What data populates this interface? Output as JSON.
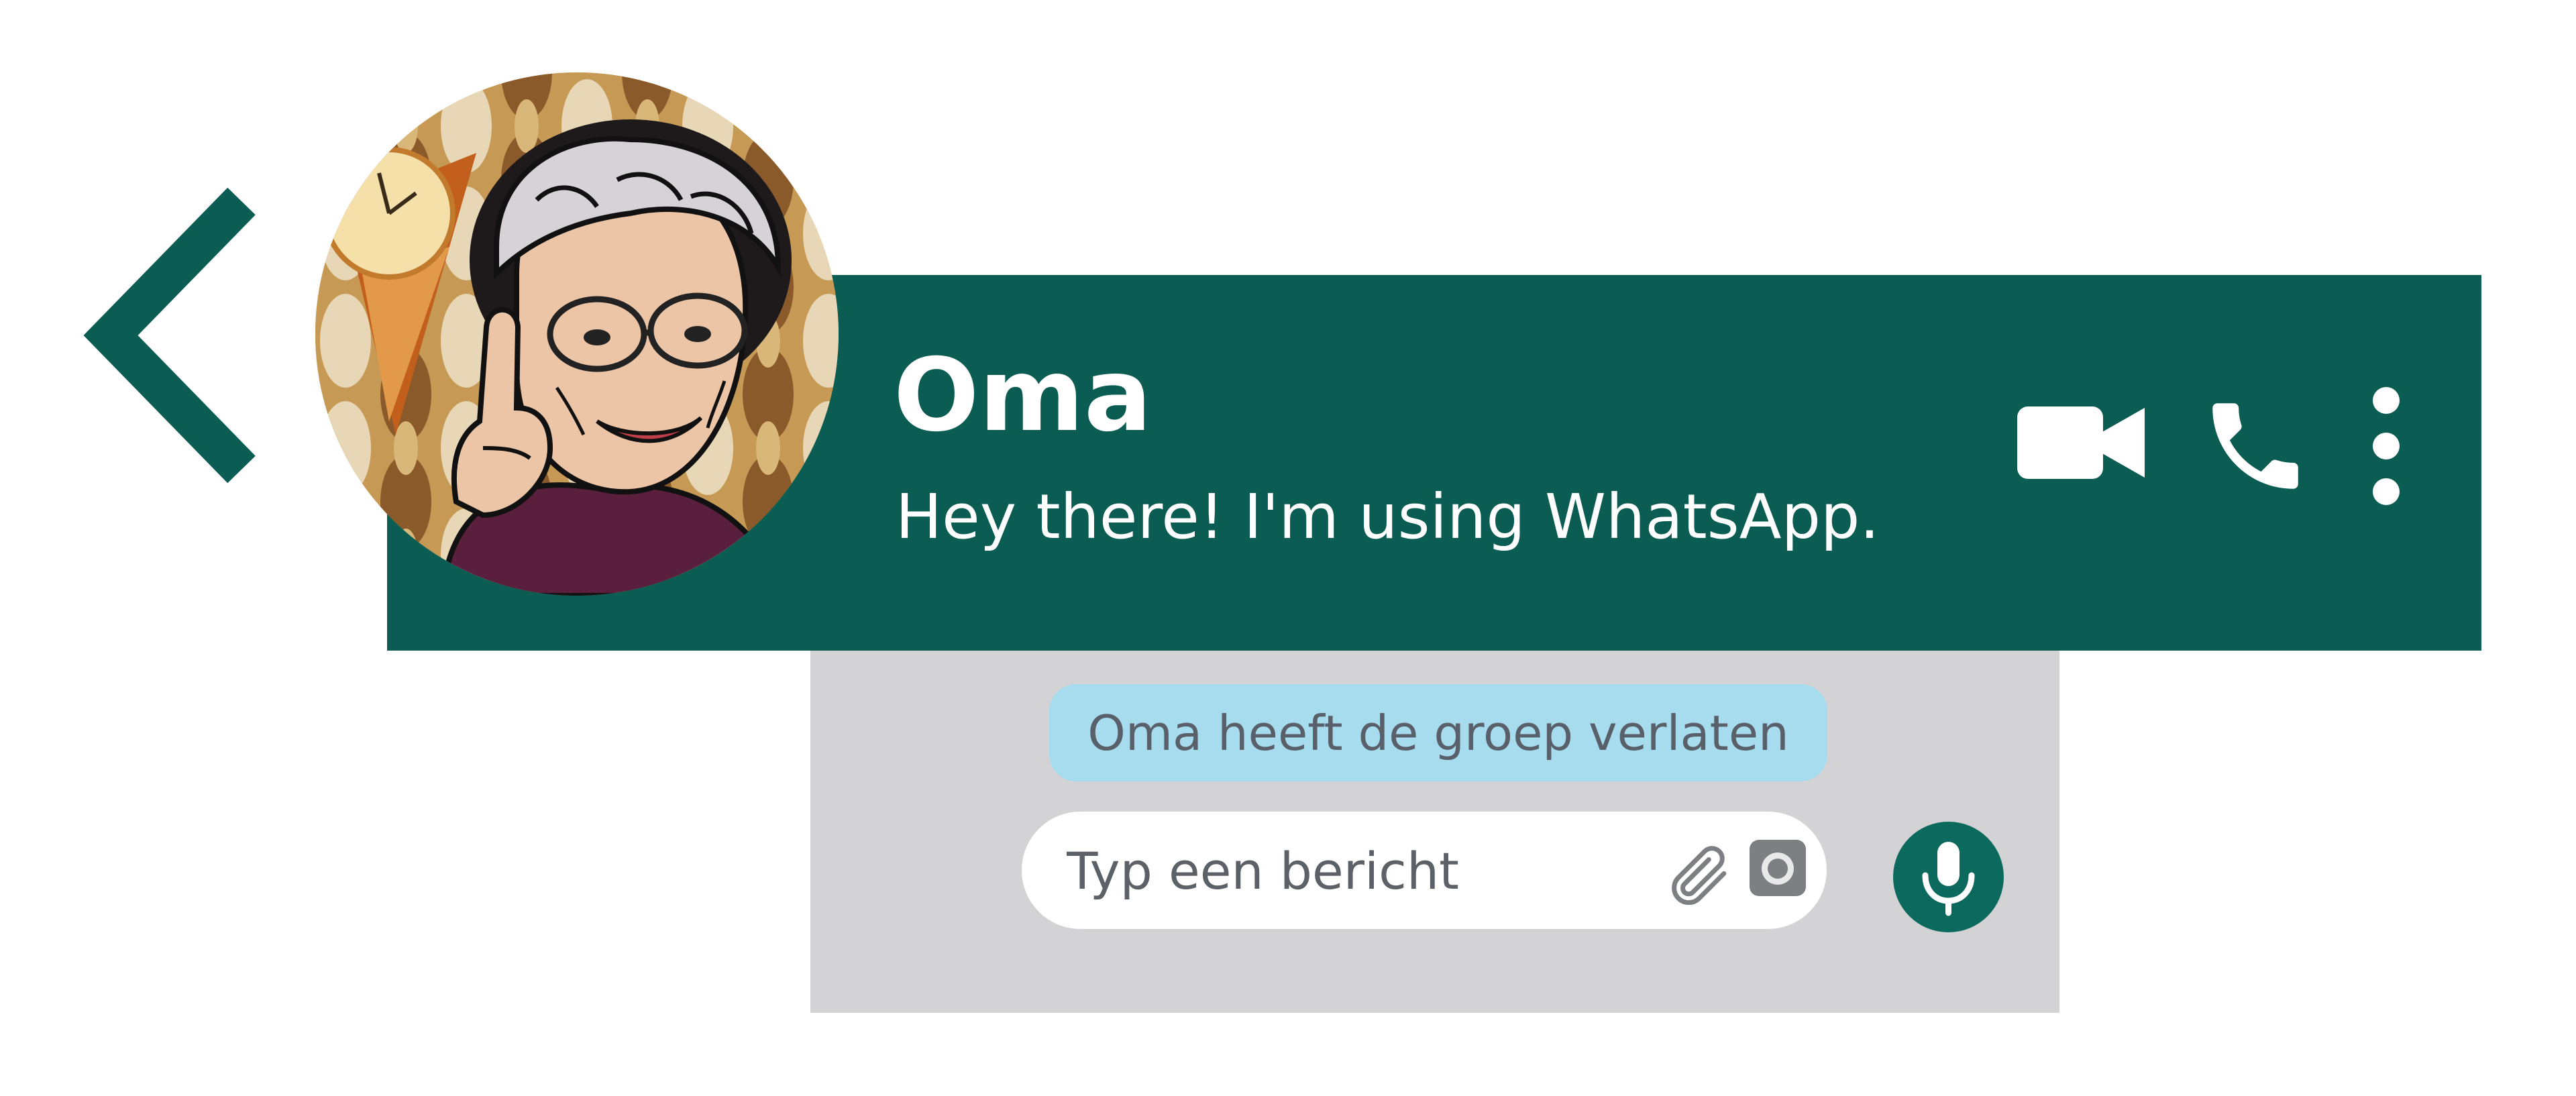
{
  "colors": {
    "header_background": "#0b5c52",
    "back_chevron": "#0b5c52",
    "chat_panel_background": "#d3d3d5",
    "system_notice_background": "#a6dcee",
    "mic_button_background": "#0b6a5d",
    "header_text": "#ffffff"
  },
  "header": {
    "back_icon": "chevron-left-icon",
    "contact_name": "Oma",
    "contact_status": "Hey there! I'm using WhatsApp.",
    "avatar": "grandmother-cartoon-avatar",
    "actions": {
      "video_call_icon": "video-camera-icon",
      "voice_call_icon": "phone-icon",
      "more_icon": "vertical-dots-icon"
    }
  },
  "chat": {
    "system_notice": "Oma heeft de groep verlaten",
    "input": {
      "placeholder": "Typ een bericht",
      "value": "",
      "attach_icon": "paperclip-icon",
      "camera_icon": "camera-icon"
    },
    "mic_icon": "microphone-icon"
  }
}
